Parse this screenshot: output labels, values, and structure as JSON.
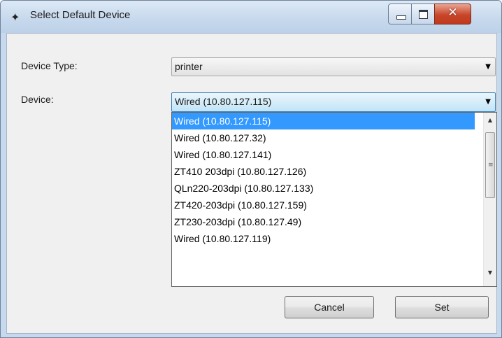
{
  "window": {
    "title": "Select Default Device",
    "app_icon": "device-app-icon",
    "controls": {
      "minimize": "minimize-icon",
      "maximize": "maximize-icon",
      "close": "close-icon",
      "close_glyph": "✕"
    }
  },
  "form": {
    "device_type_label": "Device Type:",
    "device_type_value": "printer",
    "device_label": "Device:",
    "device_value": "Wired (10.80.127.115)"
  },
  "dropdown": {
    "items": [
      "Wired (10.80.127.115)",
      "Wired (10.80.127.32)",
      "Wired (10.80.127.141)",
      "ZT410 203dpi (10.80.127.126)",
      "QLn220-203dpi (10.80.127.133)",
      "ZT420-203dpi (10.80.127.159)",
      "ZT230-203dpi (10.80.127.49)",
      "Wired (10.80.127.119)"
    ],
    "selected_index": 0
  },
  "buttons": {
    "cancel": "Cancel",
    "set": "Set"
  },
  "colors": {
    "selection": "#3399ff",
    "title_bar": "#c6d9ee",
    "close_button": "#c8452a"
  }
}
